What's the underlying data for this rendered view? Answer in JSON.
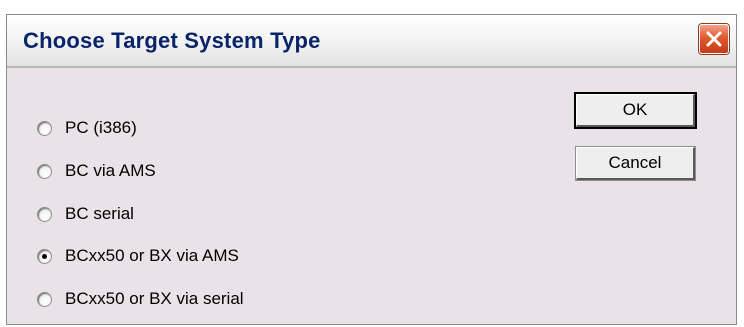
{
  "window": {
    "title": "Choose Target System Type"
  },
  "options": [
    {
      "label": "PC (i386)",
      "checked": false
    },
    {
      "label": "BC via AMS",
      "checked": false
    },
    {
      "label": "BC serial",
      "checked": false
    },
    {
      "label": "BCxx50 or BX via AMS",
      "checked": true
    },
    {
      "label": "BCxx50 or BX via serial",
      "checked": false
    }
  ],
  "buttons": {
    "ok_label": "OK",
    "cancel_label": "Cancel"
  },
  "icons": {
    "close": "close-icon",
    "radio": "radio-button"
  },
  "colors": {
    "title_text": "#0a246a",
    "close_button": "#e0592f",
    "dialog_face": "#e9e3e7"
  }
}
